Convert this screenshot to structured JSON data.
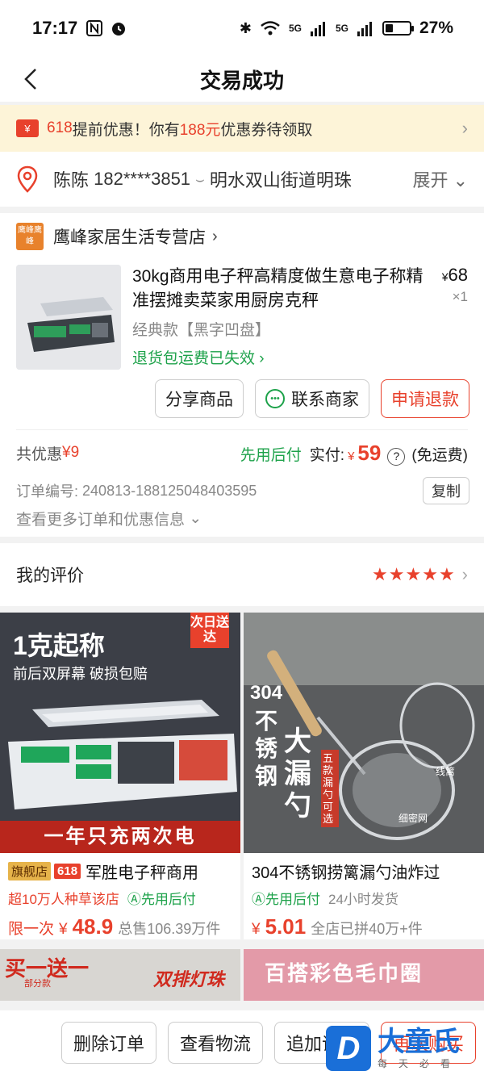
{
  "status_bar": {
    "time": "17:17",
    "signal_1": "5G",
    "signal_2": "5G",
    "battery": "27%",
    "battery_level": 0.27
  },
  "header": {
    "title": "交易成功"
  },
  "promo": {
    "prefix": "618",
    "text_1": "提前优惠！你有",
    "amount": "188元",
    "text_2": "优惠券待领取",
    "coupon_glyph": "¥"
  },
  "address": {
    "name": "陈陈",
    "phone": "182****3851",
    "detail": "明水双山街道明珠",
    "expand": "展开"
  },
  "store": {
    "logo": "鹰峰鹰峰",
    "name": "鹰峰家居生活专营店"
  },
  "product": {
    "name": "30kg商用电子秤高精度做生意电子称精准摆摊卖菜家用厨房克秤",
    "spec": "经典款【黑字凹盘】",
    "return_note": "退货包运费已失效",
    "currency": "¥",
    "price": "68",
    "qty": "×1"
  },
  "actions": {
    "share": "分享商品",
    "contact": "联系商家",
    "refund": "申请退款"
  },
  "totals": {
    "discount_label": "共优惠",
    "discount": "¥9",
    "pay_later": "先用后付",
    "paid_label": "实付:",
    "currency": "¥",
    "paid": "59",
    "help": "?",
    "shipping": "(免运费)"
  },
  "order": {
    "label": "订单编号:",
    "number": "240813-188125048403595",
    "copy": "复制",
    "more": "查看更多订单和优惠信息"
  },
  "review": {
    "label": "我的评价",
    "stars": "★★★★★",
    "rating": 5
  },
  "recs": [
    {
      "badge_flag": "旗舰店",
      "badge_618": "618",
      "title": "军胜电子秤商用",
      "sub_red": "超10万人种草该店",
      "sub_green": "先用后付",
      "price_label": "限一次",
      "currency": "¥",
      "price": "48.9",
      "sold": "总售106.39万件",
      "img_headline": "1克起称",
      "img_sub": "前后双屏幕 破损包赔",
      "img_corner": "次日送达",
      "img_footer": "一年只充两次电"
    },
    {
      "title": "304不锈钢捞篱漏勺油炸过",
      "sub_green": "先用后付",
      "sub_gray": "24小时发货",
      "currency": "¥",
      "price": "5.01",
      "sold": "全店已拼40万+件",
      "img_text_1": "304",
      "img_text_2": "不锈钢",
      "img_text_3": "大漏勺",
      "img_tag": "五款漏勺可选",
      "img_label_1": "线篱",
      "img_label_2": "细密网"
    }
  ],
  "recs_next": [
    {
      "banner": "买一送一",
      "sub": "部分款",
      "badge": "双排灯珠"
    },
    {
      "banner": "百搭彩色毛巾圈"
    }
  ],
  "bottom": {
    "delete": "删除订单",
    "logistics": "查看物流",
    "append": "追加评价",
    "rebuy": "再次购买"
  },
  "watermark": {
    "logo": "D",
    "title": "大童氏",
    "tagline": "每天必看"
  },
  "colors": {
    "accent": "#e8412c",
    "green": "#1da24a",
    "promo_bg": "#fdf4d8"
  }
}
